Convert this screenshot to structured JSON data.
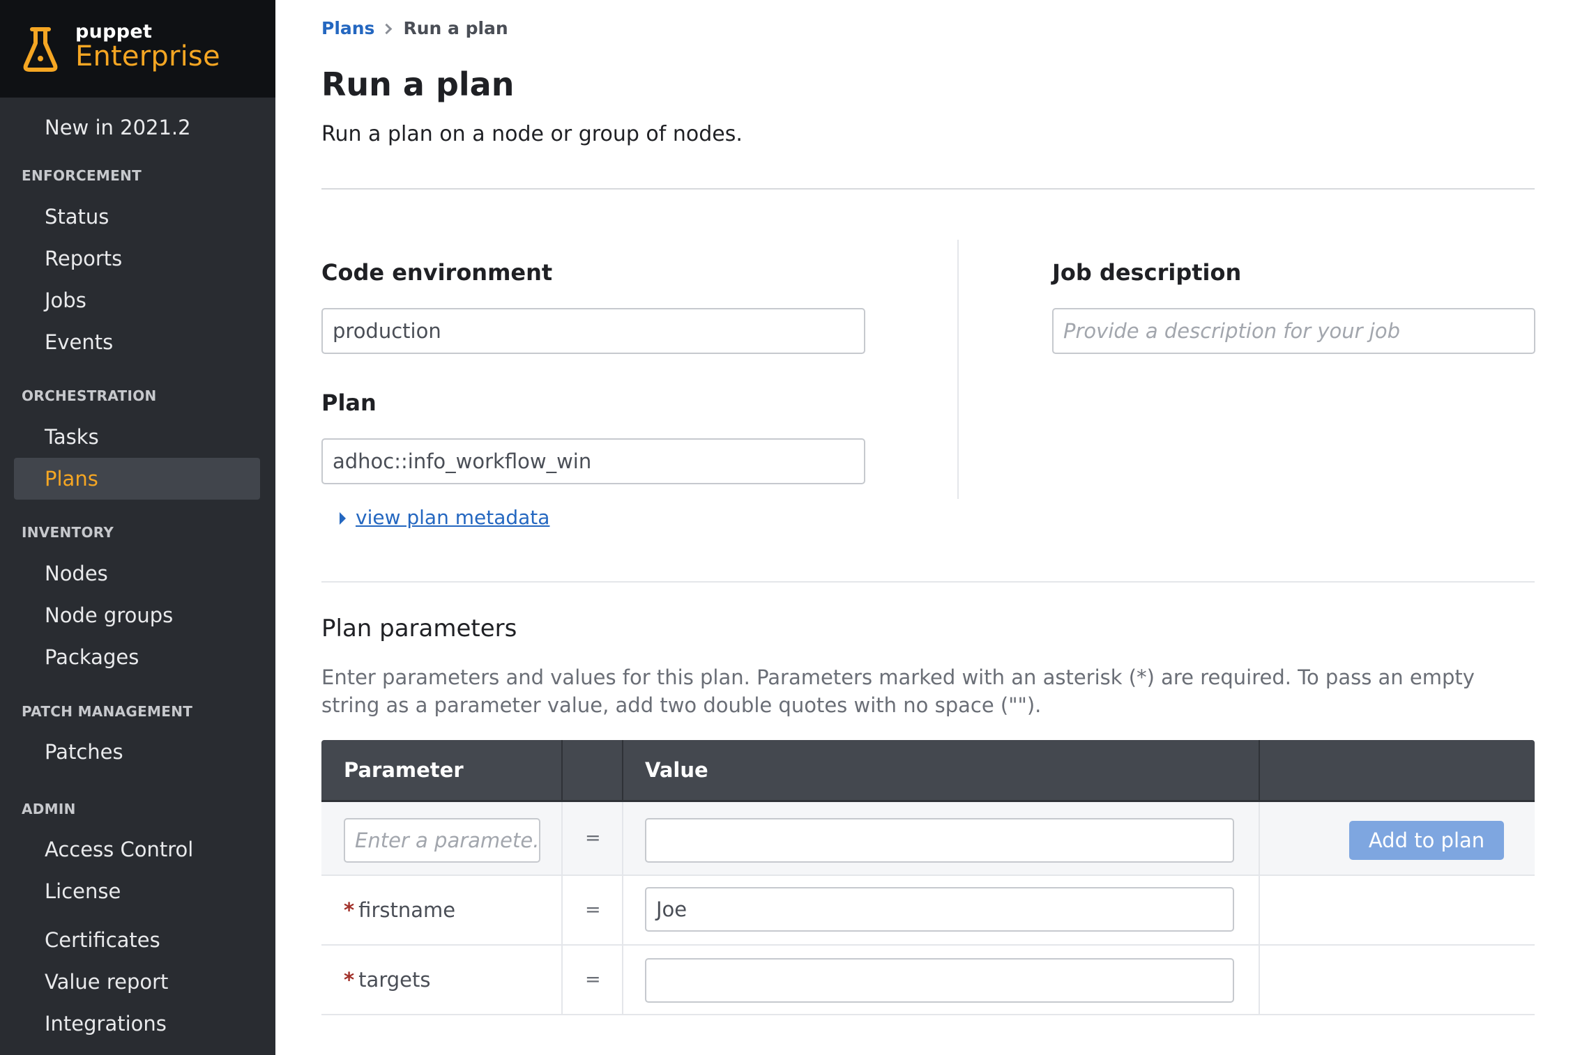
{
  "brand": {
    "small": "puppet",
    "big": "Enterprise",
    "icon": "flask-icon"
  },
  "sidebar": {
    "top_item": "New in 2021.2",
    "sections": [
      {
        "title": "ENFORCEMENT",
        "items": [
          "Status",
          "Reports",
          "Jobs",
          "Events"
        ]
      },
      {
        "title": "ORCHESTRATION",
        "items": [
          "Tasks",
          "Plans"
        ]
      },
      {
        "title": "INVENTORY",
        "items": [
          "Nodes",
          "Node groups",
          "Packages"
        ]
      },
      {
        "title": "PATCH MANAGEMENT",
        "items": [
          "Patches"
        ]
      },
      {
        "title": "ADMIN",
        "items": [
          "Access Control",
          "License",
          "Certificates",
          "Value report",
          "Integrations"
        ]
      }
    ],
    "active_item": "Plans"
  },
  "breadcrumb": {
    "parent": "Plans",
    "current": "Run a plan"
  },
  "page": {
    "title": "Run a plan",
    "subtitle": "Run a plan on a node or group of nodes."
  },
  "form": {
    "code_env_label": "Code environment",
    "code_env_value": "production",
    "plan_label": "Plan",
    "plan_value": "adhoc::info_workflow_win",
    "metadata_link": "view plan metadata",
    "job_desc_label": "Job description",
    "job_desc_placeholder": "Provide a description for your job"
  },
  "params": {
    "title": "Plan parameters",
    "description": "Enter parameters and values for this plan. Parameters marked with an asterisk (*) are required. To pass an empty string as a parameter value, add two double quotes with no space (\"\").",
    "headers": {
      "parameter": "Parameter",
      "value": "Value"
    },
    "new_param_placeholder": "Enter a paramete...",
    "add_button": "Add to plan",
    "equals": "=",
    "required_mark": "*",
    "rows": [
      {
        "name": "firstname",
        "value": "Joe"
      },
      {
        "name": "targets",
        "value": ""
      }
    ]
  }
}
